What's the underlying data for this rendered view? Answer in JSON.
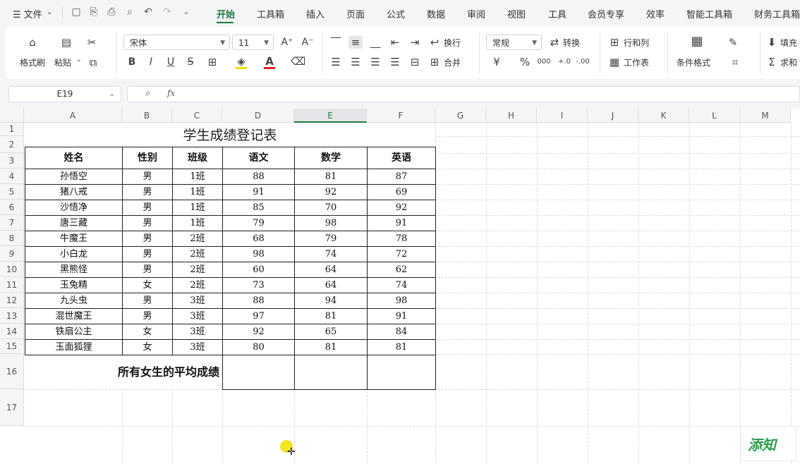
{
  "menubar": {
    "hamburger_label": "☰ 文件",
    "tabs": [
      "开始",
      "插入",
      "页面",
      "公式",
      "数据",
      "审阅",
      "视图",
      "工具",
      "会员专享",
      "效率",
      "智能工具箱",
      "财务工具箱"
    ],
    "tab_gongju": "工具箱",
    "active_tab": "开始"
  },
  "ribbon": {
    "format_painter": "格式刷",
    "paste": "粘贴",
    "font_name": "宋体",
    "font_size": "11",
    "wrap": "换行",
    "merge": "合并",
    "number_format": "常规",
    "convert": "转换",
    "rows_cols": "行和列",
    "worksheet": "工作表",
    "conditional_format": "条件格式",
    "fill": "填充",
    "sum": "求和",
    "bold": "B",
    "italic": "I",
    "underline": "U",
    "strike": "S",
    "currency": "¥",
    "percent": "%",
    "thousands": "000",
    "inc_decimal": "+.0",
    "dec_decimal": "-.00"
  },
  "formula_bar": {
    "name_box": "E19",
    "fx": "fx",
    "formula": ""
  },
  "columns": [
    "A",
    "B",
    "C",
    "D",
    "E",
    "F",
    "G",
    "H",
    "I",
    "J",
    "K",
    "L",
    "M"
  ],
  "rows": [
    "1",
    "2",
    "3",
    "4",
    "5",
    "6",
    "7",
    "8",
    "9",
    "10",
    "11",
    "12",
    "13",
    "14",
    "15",
    "16",
    "17"
  ],
  "sheet": {
    "title": "学生成绩登记表",
    "headers": [
      "姓名",
      "性别",
      "班级",
      "语文",
      "数学",
      "英语"
    ],
    "records": [
      [
        "孙悟空",
        "男",
        "1班",
        "88",
        "81",
        "87"
      ],
      [
        "猪八戒",
        "男",
        "1班",
        "91",
        "92",
        "69"
      ],
      [
        "沙悟净",
        "男",
        "1班",
        "85",
        "70",
        "92"
      ],
      [
        "唐三藏",
        "男",
        "1班",
        "79",
        "98",
        "91"
      ],
      [
        "牛魔王",
        "男",
        "2班",
        "68",
        "79",
        "78"
      ],
      [
        "小白龙",
        "男",
        "2班",
        "98",
        "74",
        "72"
      ],
      [
        "黑熊怪",
        "男",
        "2班",
        "60",
        "64",
        "62"
      ],
      [
        "玉兔精",
        "女",
        "2班",
        "73",
        "64",
        "74"
      ],
      [
        "九头虫",
        "男",
        "3班",
        "88",
        "94",
        "98"
      ],
      [
        "混世魔王",
        "男",
        "3班",
        "97",
        "81",
        "91"
      ],
      [
        "铁扇公主",
        "女",
        "3班",
        "92",
        "65",
        "84"
      ],
      [
        "玉面狐狸",
        "女",
        "3班",
        "80",
        "81",
        "81"
      ]
    ],
    "summary_label": "所有女生的平均成绩"
  },
  "logo_text": "添知",
  "colors": {
    "accent": "#1b7c3f",
    "highlight": "#f0e000"
  }
}
